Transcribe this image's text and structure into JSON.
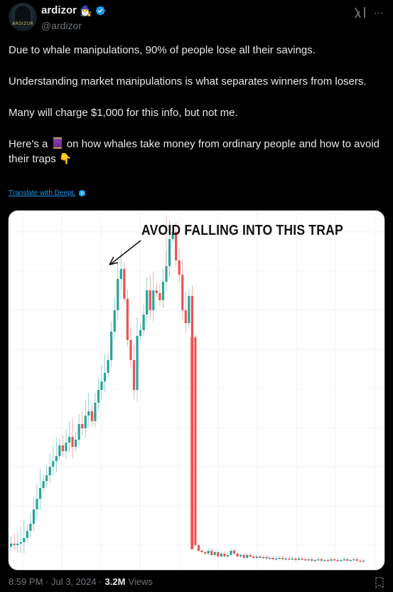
{
  "author": {
    "display_name": "ardizor",
    "name_emoji": "🧙‍♂️",
    "handle": "@ardizor",
    "avatar_text": "ARDIZOR",
    "verified": true
  },
  "tweet": {
    "paragraphs": [
      "Due to whale manipulations, 90% of people lose all their savings.",
      "Understanding market manipulations is what separates winners from losers.",
      "Many will charge $1,000 for this info, but not me."
    ],
    "last_paragraph_before": "Here's a",
    "last_paragraph_after": "on how whales take money from ordinary people and how to avoid their traps 👇",
    "translate_label": "Translate with DeepL"
  },
  "media": {
    "annotation": "AVOID FALLING INTO THIS TRAP"
  },
  "meta": {
    "time": "8:59 PM · Jul 3, 2024 ·",
    "views_count": "3.2M",
    "views_label": "Views"
  },
  "colors": {
    "up_candle": "#26a69a",
    "down_candle": "#ef5350",
    "verified_blue": "#1d9bf0",
    "link_blue": "#1d9bf0"
  }
}
